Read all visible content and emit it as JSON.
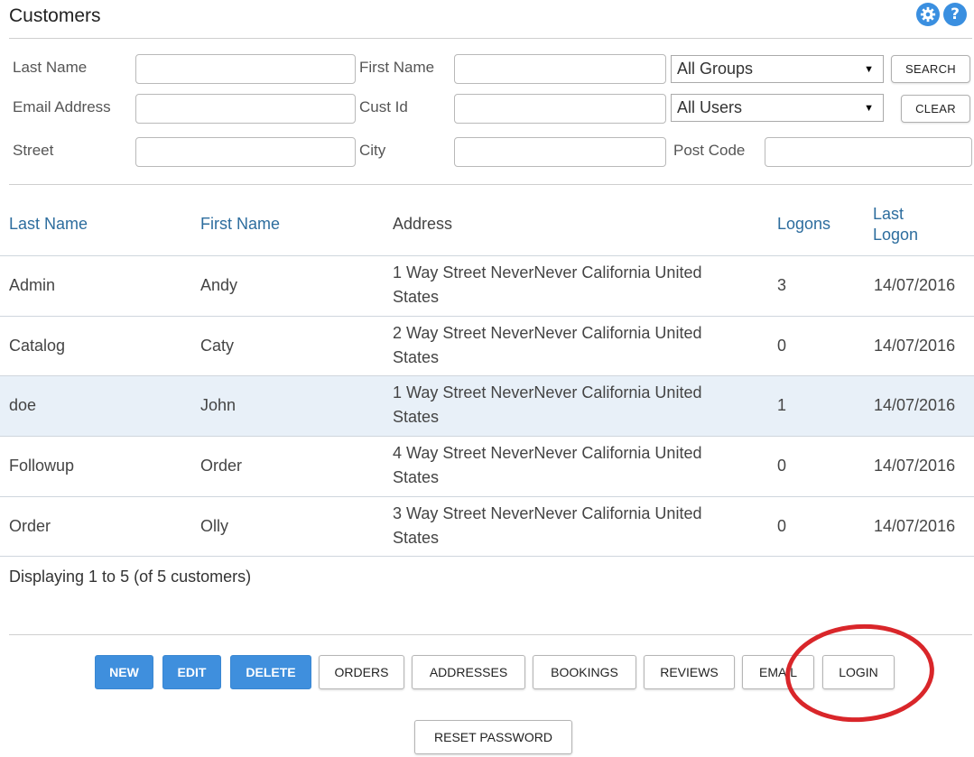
{
  "header": {
    "title": "Customers",
    "icons": [
      "gear-icon",
      "help-icon"
    ],
    "help_glyph": "?"
  },
  "filters": {
    "last_name_label": "Last Name",
    "first_name_label": "First Name",
    "email_label": "Email Address",
    "cust_id_label": "Cust Id",
    "street_label": "Street",
    "city_label": "City",
    "post_code_label": "Post Code",
    "group_select": "All Groups",
    "user_select": "All Users",
    "search_button": "SEARCH",
    "clear_button": "CLEAR",
    "last_name_value": "",
    "first_name_value": "",
    "email_value": "",
    "cust_id_value": "",
    "street_value": "",
    "city_value": "",
    "post_code_value": ""
  },
  "table": {
    "columns": {
      "last_name": "Last Name",
      "first_name": "First Name",
      "address": "Address",
      "logons": "Logons",
      "last_logon_1": "Last",
      "last_logon_2": "Logon"
    },
    "rows": [
      {
        "last_name": "Admin",
        "first_name": "Andy",
        "address_1": "1 Way Street NeverNever California United",
        "address_2": "States",
        "logons": "3",
        "last_logon": "14/07/2016"
      },
      {
        "last_name": "Catalog",
        "first_name": "Caty",
        "address_1": "2 Way Street NeverNever California United",
        "address_2": "States",
        "logons": "0",
        "last_logon": "14/07/2016"
      },
      {
        "last_name": "doe",
        "first_name": "John",
        "address_1": "1 Way Street NeverNever California United",
        "address_2": "States",
        "logons": "1",
        "last_logon": "14/07/2016"
      },
      {
        "last_name": "Followup",
        "first_name": "Order",
        "address_1": "4 Way Street NeverNever California United",
        "address_2": "States",
        "logons": "0",
        "last_logon": "14/07/2016"
      },
      {
        "last_name": "Order",
        "first_name": "Olly",
        "address_1": "3 Way Street NeverNever California United",
        "address_2": "States",
        "logons": "0",
        "last_logon": "14/07/2016"
      }
    ],
    "selected_row_index": 2,
    "footer": "Displaying 1 to 5 (of 5 customers)"
  },
  "actions": {
    "new": "NEW",
    "edit": "EDIT",
    "delete": "DELETE",
    "orders": "ORDERS",
    "addresses": "ADDRESSES",
    "bookings": "BOOKINGS",
    "reviews": "REVIEWS",
    "email": "EMAIL",
    "login": "LOGIN",
    "reset_password": "RESET PASSWORD"
  },
  "colors": {
    "primary_button": "#3f8fdd",
    "header_link": "#2d6d9e",
    "selected_row": "#e8f0f8",
    "annotation": "#d9262a"
  }
}
